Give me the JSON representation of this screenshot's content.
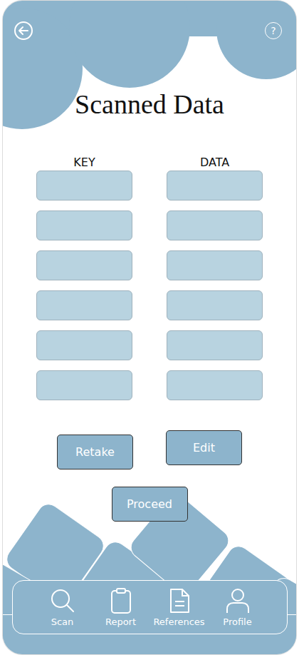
{
  "title": "Scanned Data",
  "help": "?",
  "columns": [
    "KEY",
    "DATA"
  ],
  "rows": [
    {
      "key": "",
      "data": ""
    },
    {
      "key": "",
      "data": ""
    },
    {
      "key": "",
      "data": ""
    },
    {
      "key": "",
      "data": ""
    },
    {
      "key": "",
      "data": ""
    },
    {
      "key": "",
      "data": ""
    }
  ],
  "buttons": {
    "retake": "Retake",
    "edit": "Edit",
    "proceed": "Proceed"
  },
  "nav": [
    {
      "label": "Scan",
      "icon": "search"
    },
    {
      "label": "Report",
      "icon": "clipboard"
    },
    {
      "label": "References",
      "icon": "document"
    },
    {
      "label": "Profile",
      "icon": "person"
    }
  ]
}
